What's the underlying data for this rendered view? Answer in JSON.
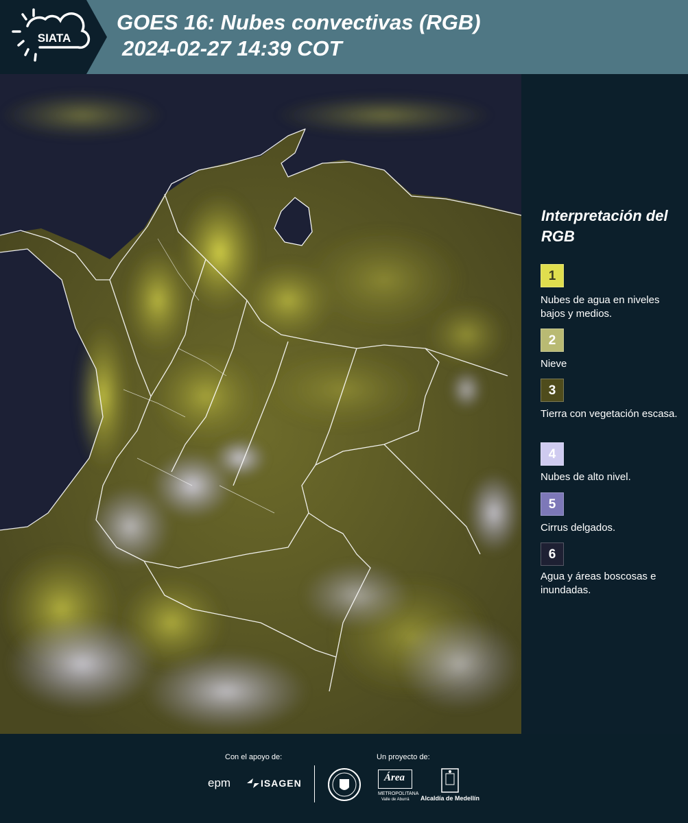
{
  "header": {
    "logo_text": "SIATA",
    "title_line1": "GOES 16: Nubes convectivas (RGB)",
    "title_line2": "2024-02-27 14:39 COT",
    "background_color": "#4f7784"
  },
  "map": {
    "description_icon": "satellite-rgb-map"
  },
  "legend": {
    "title": "Interpretación del RGB",
    "items": [
      {
        "number": "1",
        "label": "Nubes de agua en niveles bajos y medios.",
        "color": "#e0de4e",
        "text_color": "#3a3a20"
      },
      {
        "number": "2",
        "label": "Nieve",
        "color": "#b9ba73",
        "text_color": "#ffffff"
      },
      {
        "number": "3",
        "label": "Tierra con vegetación escasa.",
        "color": "#4f4c1c",
        "text_color": "#ffffff"
      },
      {
        "number": "4",
        "label": "Nubes de alto nivel.",
        "color": "#cfcbf0",
        "text_color": "#ffffff"
      },
      {
        "number": "5",
        "label": "Cirrus delgados.",
        "color": "#7d78b8",
        "text_color": "#ffffff"
      },
      {
        "number": "6",
        "label": "Agua y áreas boscosas e inundadas.",
        "color": "#1e2033",
        "text_color": "#ffffff"
      }
    ]
  },
  "footer": {
    "support_caption": "Con el apoyo de:",
    "project_caption": "Un proyecto de:",
    "epm": "epm",
    "isagen": "ISAGEN",
    "metropolitana": "Área",
    "metropolitana_sub": "METROPOLITANA",
    "metropolitana_sub2": "Valle de Aburrá",
    "alcaldia": "Alcaldía de Medellín"
  }
}
